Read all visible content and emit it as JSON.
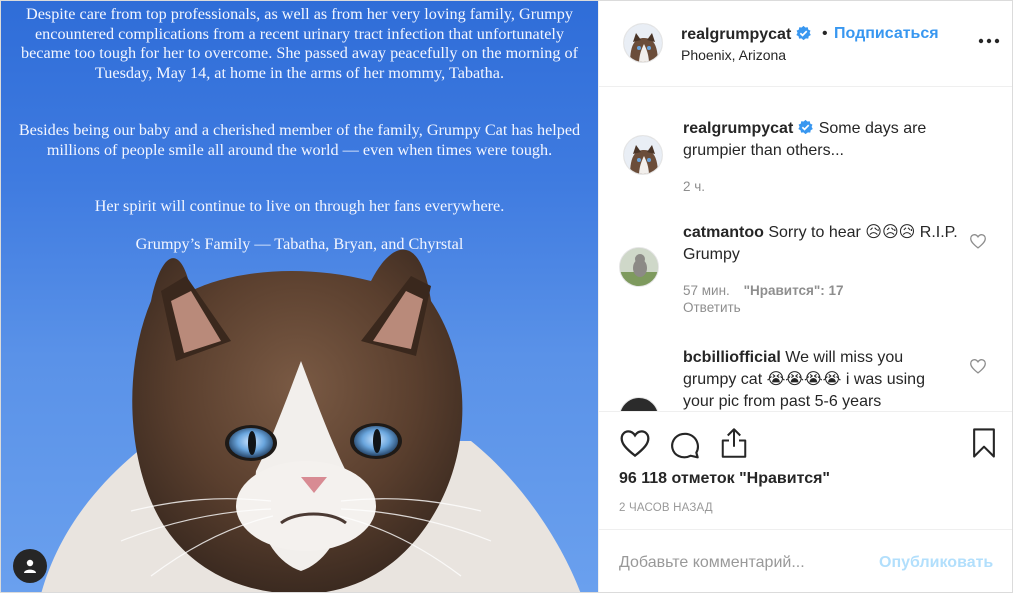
{
  "media": {
    "paragraphs": [
      "Despite care from top professionals, as well as from her very loving family, Grumpy encountered complications from a recent urinary tract infection that unfortunately became too tough for her to overcome.  She passed away peacefully on the morning of Tuesday, May 14, at home in the arms of her mommy, Tabatha.",
      "Besides being our baby and a cherished member of the family, Grumpy Cat has helped millions of people smile all around the world — even when times were tough.",
      "Her spirit will continue to live on through her fans everywhere.",
      "Grumpy’s Family — Tabatha, Bryan, and Chyrstal"
    ],
    "user_tag_icon": "person-icon"
  },
  "header": {
    "username": "realgrumpycat",
    "separator": "•",
    "follow_label": "Подписаться",
    "location": "Phoenix, Arizona",
    "more_icon": "more-horizontal-icon"
  },
  "caption": {
    "username": "realgrumpycat",
    "text": "Some days are grumpier than others...",
    "time": "2 ч."
  },
  "comments": [
    {
      "username": "catmantoo",
      "text": "Sorry to hear 😥😥😥 R.I.P. Grumpy",
      "time": "57 мин.",
      "likes": "\"Нравится\": 17",
      "reply": "Ответить"
    },
    {
      "username": "bcbilliofficial",
      "text": "We will miss you grumpy cat 😭😭😭😭 i was using your pic from past 5-6 years"
    }
  ],
  "actions": {
    "likes": "96 118 отметок \"Нравится\"",
    "time": "2 ЧАСОВ НАЗАД"
  },
  "comment_box": {
    "placeholder": "Добавьте комментарий...",
    "publish_label": "Опубликовать"
  },
  "colors": {
    "accent": "#3897f0",
    "publish_disabled": "#b2dffc",
    "media_bg": "#3f7be0"
  }
}
